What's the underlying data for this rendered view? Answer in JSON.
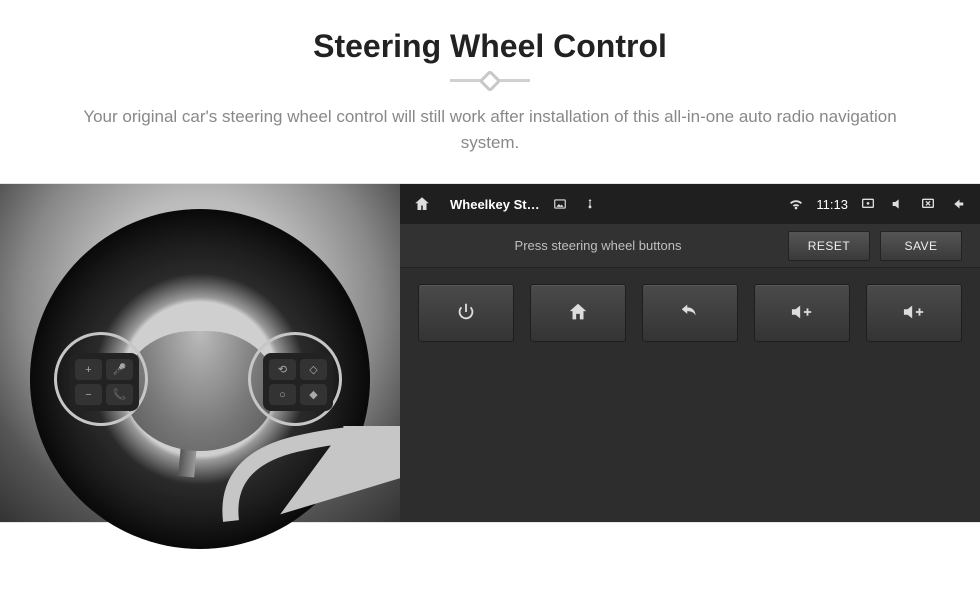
{
  "header": {
    "title": "Steering Wheel Control",
    "subtitle": "Your original car's steering wheel control will still work after installation of this all-in-one auto radio navigation system."
  },
  "wheel": {
    "left_buttons": [
      "+",
      "🎤",
      "−",
      "📞"
    ],
    "right_buttons": [
      "⟲",
      "◇",
      "○",
      "◆"
    ]
  },
  "device": {
    "status": {
      "home_icon": "home-icon",
      "app_title": "Wheelkey St…",
      "indicators": [
        "image-icon",
        "usb-icon"
      ],
      "right_icons": [
        "wifi-icon",
        "screenshot-icon",
        "mute-icon",
        "close-icon",
        "back-icon"
      ],
      "time": "11:13"
    },
    "toolbar": {
      "hint": "Press steering wheel buttons",
      "reset_label": "RESET",
      "save_label": "SAVE"
    },
    "functions": [
      {
        "name": "power",
        "icon": "power-icon"
      },
      {
        "name": "home",
        "icon": "home-icon"
      },
      {
        "name": "back",
        "icon": "back-icon"
      },
      {
        "name": "volume-up-1",
        "icon": "volume-up-icon"
      },
      {
        "name": "volume-up-2",
        "icon": "volume-up-icon"
      }
    ]
  },
  "colors": {
    "accent": "#f3c830",
    "device_bg": "#2d2d2d"
  }
}
